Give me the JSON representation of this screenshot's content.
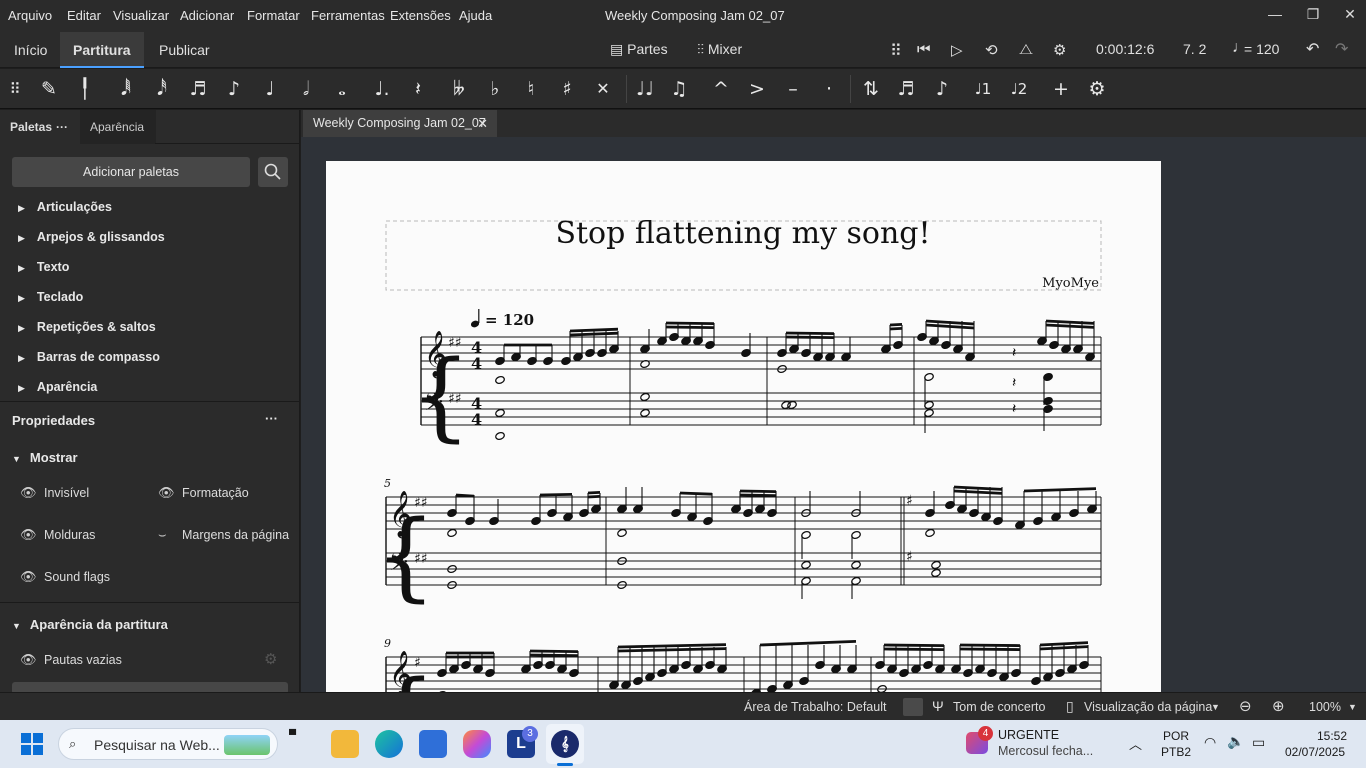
{
  "menu": [
    "Arquivo",
    "Editar",
    "Visualizar",
    "Adicionar",
    "Formatar",
    "Ferramentas",
    "Extensões",
    "Ajuda"
  ],
  "window_title": "Weekly Composing Jam 02_07",
  "mode_tabs": {
    "home": "Início",
    "score": "Partitura",
    "publish": "Publicar"
  },
  "mode_buttons": {
    "parts": "Partes",
    "mixer": "Mixer"
  },
  "playback": {
    "time": "0:00:12:6",
    "position": "7. 2",
    "tempo_value": "= 120"
  },
  "left_tabs": {
    "palettes": "Paletas",
    "more": "···",
    "appearance": "Aparência"
  },
  "add_palettes": "Adicionar paletas",
  "palettes": [
    "Articulações",
    "Arpejos & glissandos",
    "Texto",
    "Teclado",
    "Repetições & saltos",
    "Barras de compasso",
    "Aparência"
  ],
  "properties": {
    "title": "Propriedades",
    "more": "···",
    "show_section": "Mostrar",
    "invisible": "Invisível",
    "formatting": "Formatação",
    "frames": "Molduras",
    "page_margins": "Margens da página",
    "sound_flags": "Sound flags",
    "score_appearance": "Aparência da partitura",
    "empty_staves": "Pautas vazias"
  },
  "doc_tab": "Weekly Composing Jam 02_07",
  "score": {
    "title": "Stop flattening my song!",
    "composer": "MyoMye",
    "tempo": "= 120",
    "time_sig_top": "4",
    "time_sig_bottom": "4",
    "measure_5": "5",
    "measure_9": "9"
  },
  "status": {
    "workspace": "Área de Trabalho: Default",
    "concert_pitch": "Tom de concerto",
    "view": "Visualização da página",
    "zoom": "100%"
  },
  "taskbar": {
    "search": "Pesquisar na Web...",
    "notif_title": "URGENTE",
    "notif_sub": "Mercosul fecha...",
    "notif_count": "4",
    "lang1": "POR",
    "lang2": "PTB2",
    "time": "15:52",
    "date": "02/07/2025",
    "badge": "3"
  },
  "colors": {
    "accent": "#4aa0ff",
    "panel": "#2b2b2b",
    "canvas": "#2e3238",
    "page": "#fbfbfb"
  }
}
